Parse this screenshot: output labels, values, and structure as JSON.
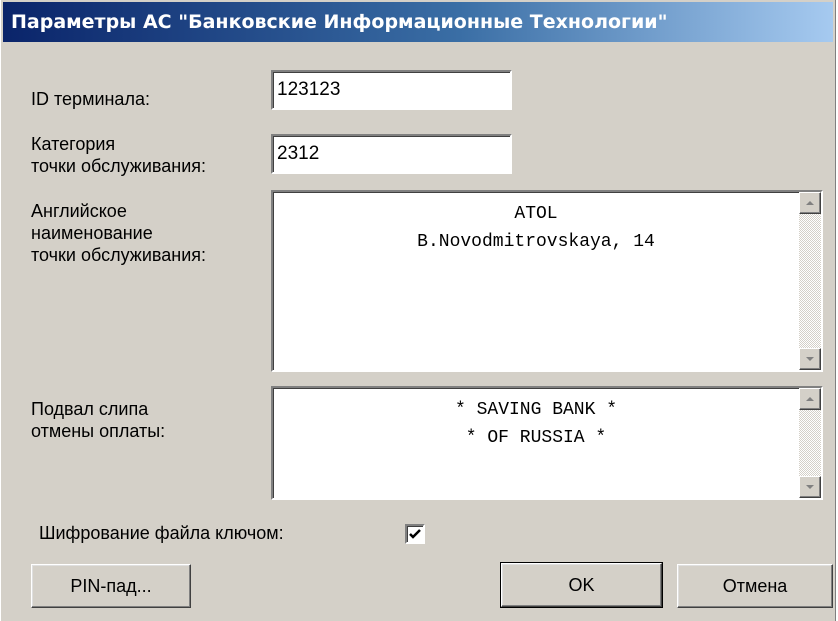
{
  "window": {
    "title": "Параметры АС \"Банковские Информационные Технологии\""
  },
  "terminal_id": {
    "label": "ID терминала:",
    "value": "123123"
  },
  "service_category": {
    "label_line1": "Категория",
    "label_line2": "точки обслуживания:",
    "value": "2312"
  },
  "english_name": {
    "label_line1": "Английское",
    "label_line2": "наименование",
    "label_line3": "точки обслуживания:",
    "text": "ATOL\nB.Novodmitrovskaya, 14"
  },
  "slip_footer": {
    "label_line1": "Подвал слипа",
    "label_line2": "отмены оплаты:",
    "text": "* SAVING BANK *\n* OF RUSSIA *"
  },
  "encryption": {
    "label": "Шифрование файла ключом:",
    "checked": true
  },
  "buttons": {
    "pinpad": "PIN-пад...",
    "ok": "OK",
    "cancel": "Отмена"
  }
}
